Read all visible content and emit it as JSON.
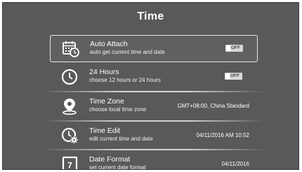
{
  "page": {
    "title": "Time"
  },
  "settings": [
    {
      "icon": "calendar-clock-icon",
      "label": "Auto Attach",
      "sublabel": "auto get current time and date",
      "toggle": "OFF",
      "selected": true
    },
    {
      "icon": "clock-icon",
      "label": "24 Hours",
      "sublabel": "choose 12 hours or 24 hours",
      "toggle": "OFF"
    },
    {
      "icon": "location-pin-icon",
      "label": "Time Zone",
      "sublabel": "choose local time zone",
      "value": "GMT+08:00, China Standard"
    },
    {
      "icon": "clock-gear-icon",
      "label": "Time Edit",
      "sublabel": "edit current time and date",
      "value": "04/11/2016 AM 10:52"
    },
    {
      "icon": "calendar-day-icon",
      "label": "Date Format",
      "sublabel": "set current date format",
      "value": "04/11/2016",
      "icon_text": "7"
    }
  ],
  "colors": {
    "background": "#58595b",
    "text": "#ffffff",
    "toggle": "#d9d9d9"
  }
}
